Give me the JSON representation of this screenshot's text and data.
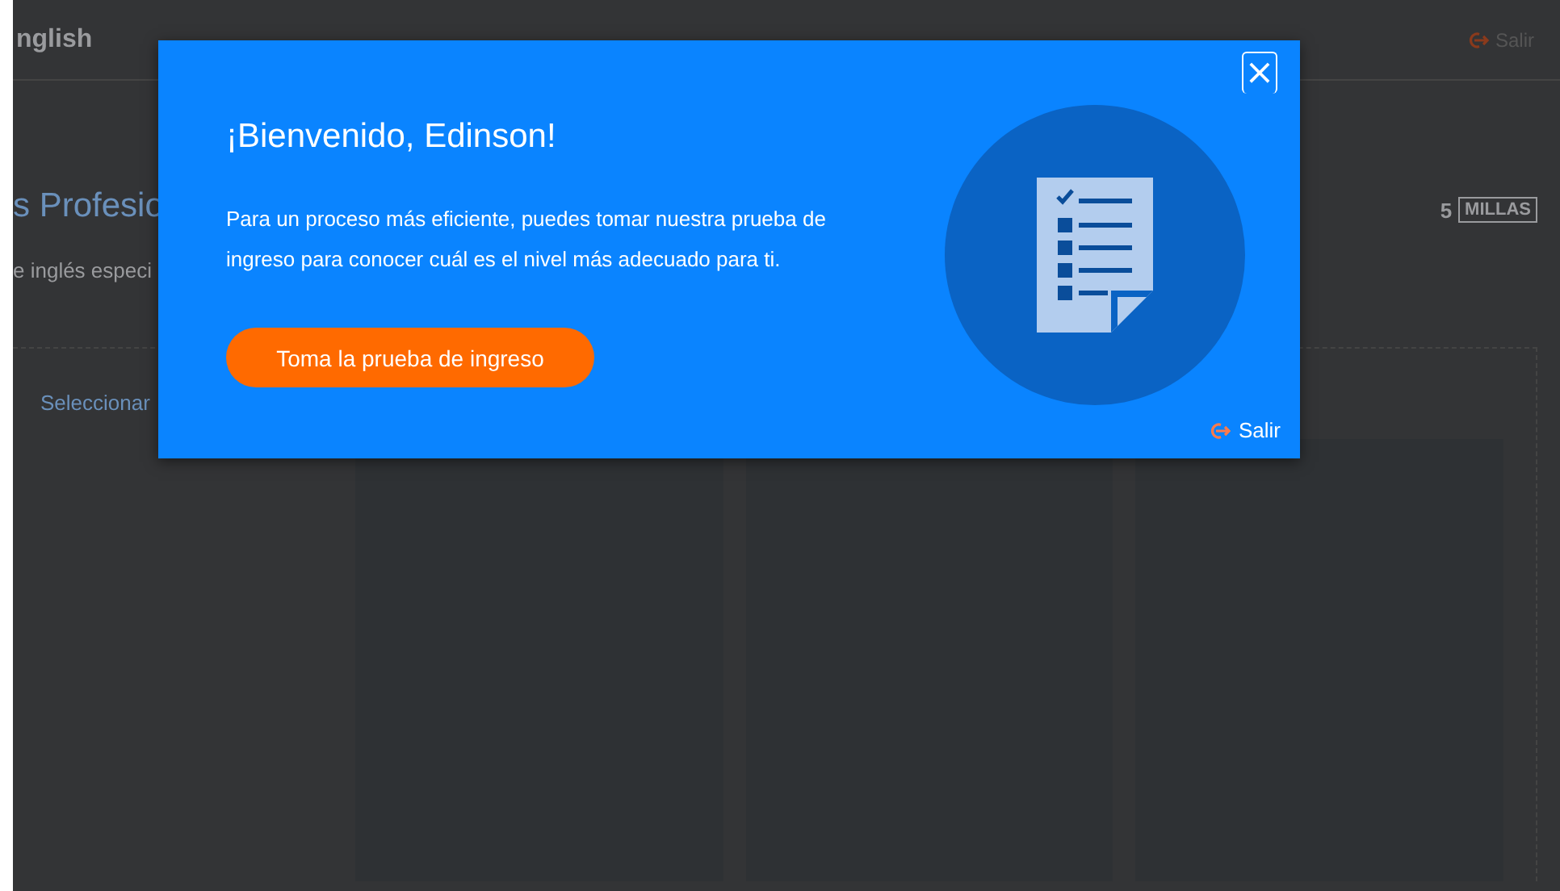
{
  "header": {
    "brand": "nglish",
    "logout": "Salir"
  },
  "page": {
    "title": "s Profesio",
    "subtitle": "e inglés especi",
    "miles_count": "5",
    "miles_unit": "MILLAS",
    "select_label": "Seleccionar"
  },
  "modal": {
    "title": "¡Bienvenido, Edinson!",
    "message": "Para un proceso más eficiente, puedes tomar nuestra prueba de ingreso para conocer cuál es el nivel más adecuado para ti.",
    "button": "Toma la prueba de ingreso",
    "close": "×",
    "logout": "Salir"
  }
}
